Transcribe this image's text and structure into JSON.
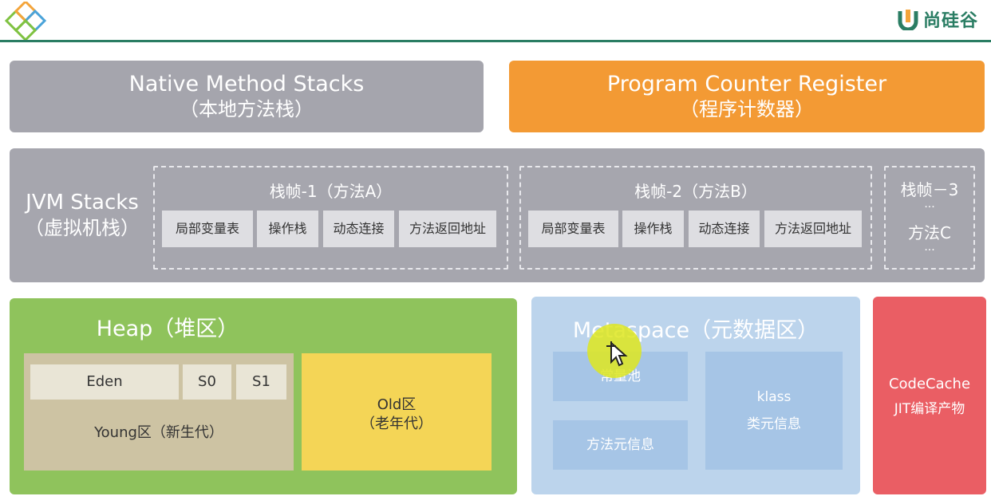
{
  "brand": {
    "name": "尚硅谷"
  },
  "native_method_stacks": {
    "title": "Native Method Stacks",
    "subtitle": "（本地方法栈）"
  },
  "program_counter_register": {
    "title": "Program Counter Register",
    "subtitle": "（程序计数器）"
  },
  "jvm_stacks": {
    "title": "JVM Stacks",
    "subtitle": "（虚拟机栈）",
    "frames": [
      {
        "title": "栈帧-1（方法A）",
        "cells": [
          "局部变量表",
          "操作栈",
          "动态连接",
          "方法返回地址"
        ]
      },
      {
        "title": "栈帧-2（方法B）",
        "cells": [
          "局部变量表",
          "操作栈",
          "动态连接",
          "方法返回地址"
        ]
      }
    ],
    "frame3": {
      "title": "栈帧－3",
      "dots_top": "...",
      "method": "方法C",
      "dots_bottom": "..."
    }
  },
  "heap": {
    "title": "Heap（堆区）",
    "eden": "Eden",
    "s0": "S0",
    "s1": "S1",
    "young": "Young区（新生代）",
    "old_line1": "Old区",
    "old_line2": "（老年代）"
  },
  "metaspace": {
    "title": "Metaspace（元数据区）",
    "constant_pool": "常量池",
    "method_meta": "方法元信息",
    "klass": "klass",
    "class_meta": "类元信息"
  },
  "code_cache": {
    "line1": "CodeCache",
    "line2": "JIT编译产物"
  },
  "colors": {
    "native": "#a5a5ad",
    "pcr": "#f39a34",
    "jvm": "#a6a6ae",
    "heap": "#8fc35c",
    "young": "#cdc3a3",
    "old": "#f4d556",
    "metaspace": "#bcd4ec",
    "code_cache": "#ea5e64",
    "brand": "#2a7d63"
  }
}
